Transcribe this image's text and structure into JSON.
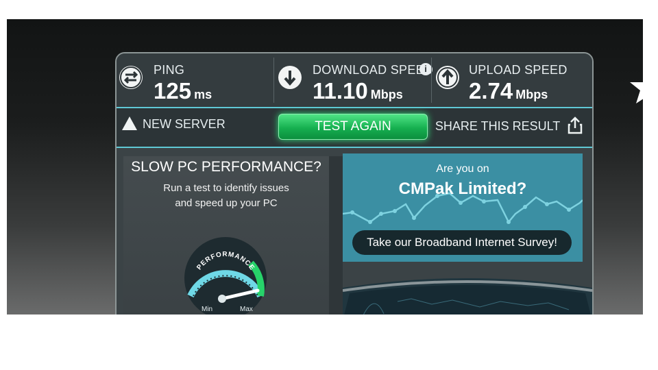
{
  "stats": {
    "ping": {
      "label": "PING",
      "value": "125",
      "unit": "ms"
    },
    "download": {
      "label": "DOWNLOAD SPEED",
      "value": "11.10",
      "unit": "Mbps"
    },
    "upload": {
      "label": "UPLOAD SPEED",
      "value": "2.74",
      "unit": "Mbps"
    },
    "info_glyph": "i"
  },
  "actions": {
    "new_server": "NEW SERVER",
    "test_again": "TEST AGAIN",
    "share": "SHARE THIS RESULT"
  },
  "pc_ad": {
    "title": "SLOW PC PERFORMANCE?",
    "line1": "Run a test to identify issues",
    "line2": "and speed up your PC",
    "gauge_label": "PERFORMANCE",
    "gauge_min": "Min",
    "gauge_max": "Max"
  },
  "survey": {
    "question_line1": "Are you on",
    "question_line2": "CMPak Limited?",
    "button": "Take our Broadband Internet Survey!"
  },
  "colors": {
    "accent_cyan": "#5fc9d6",
    "accent_green": "#16b050",
    "panel": "#3b4346",
    "survey_bg": "#3b8fa3"
  },
  "icons": [
    "ping-arrows-icon",
    "download-arrow-icon",
    "upload-arrow-icon",
    "info-icon",
    "server-triangle-icon",
    "share-icon",
    "star-icon"
  ]
}
